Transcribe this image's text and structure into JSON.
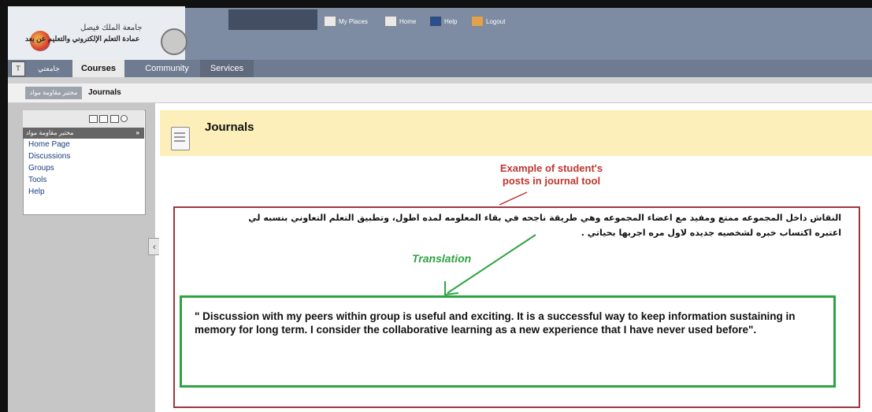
{
  "header": {
    "logo_line1": "جامعة الملك فيصل",
    "logo_line2": "عمادة التعلم الإلكتروني والتعليم عن بعد",
    "toplinks": [
      {
        "label": "My Places",
        "icon": "my-places-icon"
      },
      {
        "label": "Home",
        "icon": "home-icon"
      },
      {
        "label": "Help",
        "icon": "help-icon"
      },
      {
        "label": "Logout",
        "icon": "logout-icon"
      }
    ]
  },
  "tabs": [
    {
      "label": "جامعتي"
    },
    {
      "label": "Courses"
    },
    {
      "label": "Community"
    },
    {
      "label": "Services"
    }
  ],
  "breadcrumb": {
    "course": "مختبر مقاومة مواد",
    "current": "Journals"
  },
  "sidebar": {
    "course_title": "مختبر مقاومة مواد",
    "items": [
      "Home Page",
      "Discussions",
      "Groups",
      "Tools",
      "Help"
    ]
  },
  "page": {
    "title": "Journals"
  },
  "annotation": {
    "example_line1": "Example of student's",
    "example_line2": "posts in journal tool",
    "translation_label": "Translation"
  },
  "post": {
    "arabic_line1": "النقاش داخل المجموعه ممتع ومفيد مع اعضاء المجموعه وهي طريقة ناجحه في بقاء المعلومه لمده اطول، وتطبيق التعلم التعاوني بنسبه لي",
    "arabic_line2": "اعتبره اكتساب خبره لشخصيه جديده لاول مره اجربها بحياتي .",
    "translation": "\" Discussion with my peers within group is useful and exciting. It is a successful way to keep information sustaining in memory for long term. I consider the collaborative learning as a new experience that I have never used before\"."
  },
  "colors": {
    "header": "#7d8ba3",
    "title_bar": "#fcefb9",
    "red_annotation": "#c0362f",
    "green_annotation": "#2ea342"
  }
}
